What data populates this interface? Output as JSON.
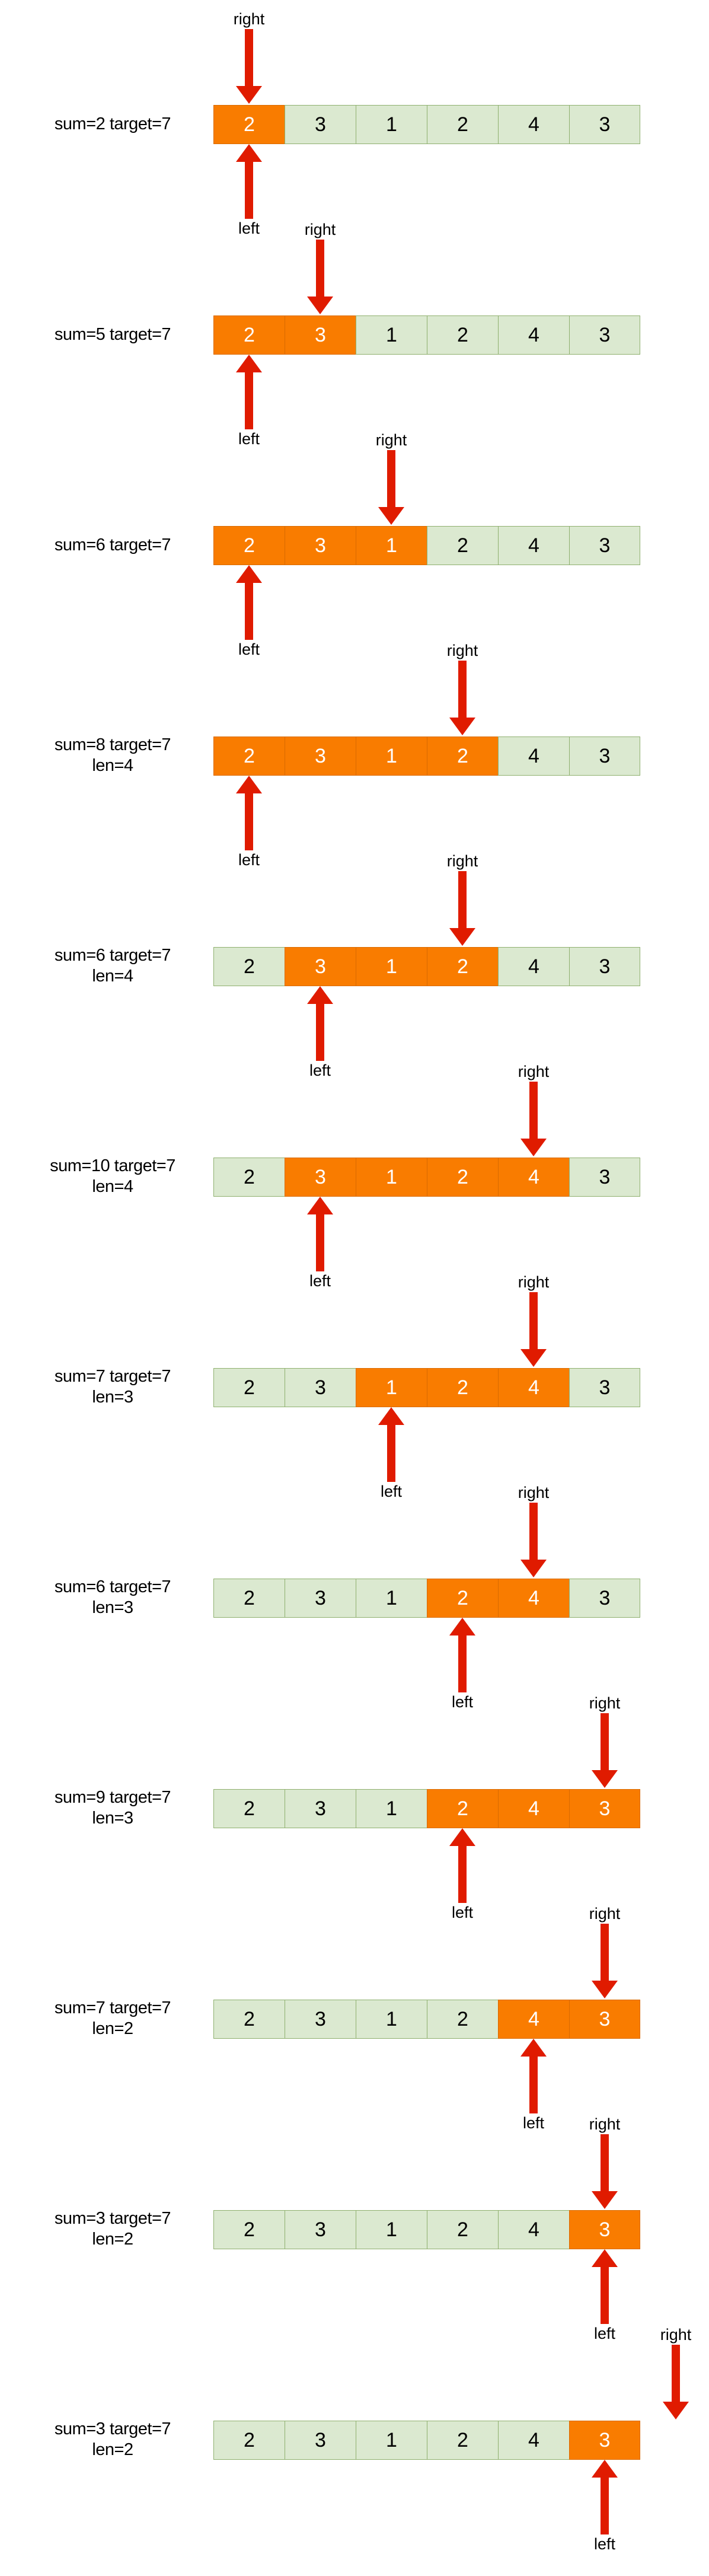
{
  "colors": {
    "highlight_fill": "#f97c00",
    "highlight_border": "#d96a00",
    "highlight_text": "#ffffff",
    "plain_fill": "#dbe9d0",
    "plain_border": "#8fb06f",
    "plain_text": "#000000",
    "arrow": "#e01b00",
    "background": "#ffffff"
  },
  "labels": {
    "left_pointer": "left",
    "right_pointer": "right"
  },
  "chart_data": {
    "type": "table",
    "title": "",
    "array": [
      2,
      3,
      1,
      2,
      4,
      3
    ],
    "target": 7,
    "steps": [
      {
        "label": "sum=2 target=7",
        "sum": 2,
        "target": 7,
        "len": null,
        "left_index": 0,
        "right_index": 0,
        "highlight_from": 0,
        "highlight_to": 0,
        "values": [
          2,
          3,
          1,
          2,
          4,
          3
        ]
      },
      {
        "label": "sum=5 target=7",
        "sum": 5,
        "target": 7,
        "len": null,
        "left_index": 0,
        "right_index": 1,
        "highlight_from": 0,
        "highlight_to": 1,
        "values": [
          2,
          3,
          1,
          2,
          4,
          3
        ]
      },
      {
        "label": "sum=6 target=7",
        "sum": 6,
        "target": 7,
        "len": null,
        "left_index": 0,
        "right_index": 2,
        "highlight_from": 0,
        "highlight_to": 2,
        "values": [
          2,
          3,
          1,
          2,
          4,
          3
        ]
      },
      {
        "label": "sum=8 target=7\nlen=4",
        "sum": 8,
        "target": 7,
        "len": 4,
        "left_index": 0,
        "right_index": 3,
        "highlight_from": 0,
        "highlight_to": 3,
        "values": [
          2,
          3,
          1,
          2,
          4,
          3
        ]
      },
      {
        "label": "sum=6 target=7\nlen=4",
        "sum": 6,
        "target": 7,
        "len": 4,
        "left_index": 1,
        "right_index": 3,
        "highlight_from": 1,
        "highlight_to": 3,
        "values": [
          2,
          3,
          1,
          2,
          4,
          3
        ]
      },
      {
        "label": "sum=10 target=7\nlen=4",
        "sum": 10,
        "target": 7,
        "len": 4,
        "left_index": 1,
        "right_index": 4,
        "highlight_from": 1,
        "highlight_to": 4,
        "values": [
          2,
          3,
          1,
          2,
          4,
          3
        ]
      },
      {
        "label": "sum=7 target=7\nlen=3",
        "sum": 7,
        "target": 7,
        "len": 3,
        "left_index": 2,
        "right_index": 4,
        "highlight_from": 2,
        "highlight_to": 4,
        "values": [
          2,
          3,
          1,
          2,
          4,
          3
        ]
      },
      {
        "label": "sum=6 target=7\nlen=3",
        "sum": 6,
        "target": 7,
        "len": 3,
        "left_index": 3,
        "right_index": 4,
        "highlight_from": 3,
        "highlight_to": 4,
        "values": [
          2,
          3,
          1,
          2,
          4,
          3
        ]
      },
      {
        "label": "sum=9 target=7\nlen=3",
        "sum": 9,
        "target": 7,
        "len": 3,
        "left_index": 3,
        "right_index": 5,
        "highlight_from": 3,
        "highlight_to": 5,
        "values": [
          2,
          3,
          1,
          2,
          4,
          3
        ]
      },
      {
        "label": "sum=7 target=7\nlen=2",
        "sum": 7,
        "target": 7,
        "len": 2,
        "left_index": 4,
        "right_index": 5,
        "highlight_from": 4,
        "highlight_to": 5,
        "values": [
          2,
          3,
          1,
          2,
          4,
          3
        ]
      },
      {
        "label": "sum=3 target=7\nlen=2",
        "sum": 3,
        "target": 7,
        "len": 2,
        "left_index": 5,
        "right_index": 5,
        "highlight_from": 5,
        "highlight_to": 5,
        "values": [
          2,
          3,
          1,
          2,
          4,
          3
        ]
      },
      {
        "label": "sum=3 target=7\nlen=2",
        "sum": 3,
        "target": 7,
        "len": 2,
        "left_index": 5,
        "right_index": 6,
        "highlight_from": 5,
        "highlight_to": 5,
        "values": [
          2,
          3,
          1,
          2,
          4,
          3
        ]
      }
    ]
  }
}
